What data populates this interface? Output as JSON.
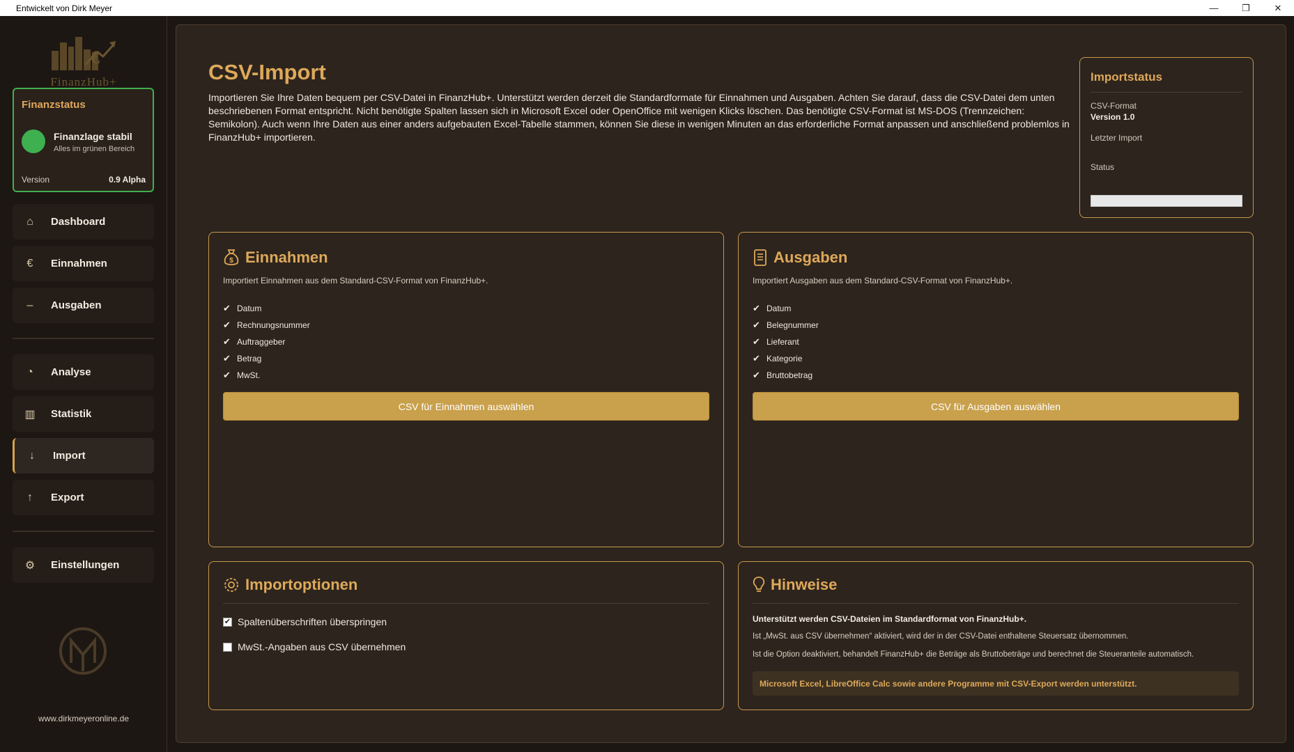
{
  "window": {
    "title": "Entwickelt von Dirk Meyer",
    "controls": {
      "minimize": "—",
      "maximize": "❐",
      "close": "✕"
    }
  },
  "sidebar": {
    "logo_text": "FinanzHub+",
    "finanzstatus": {
      "title": "Finanzstatus",
      "main": "Finanzlage stabil",
      "sub": "Alles im grünen Bereich",
      "version_label": "Version",
      "version_value": "0.9 Alpha",
      "status_color": "#3fb04f"
    },
    "nav": [
      {
        "label": "Dashboard",
        "icon": "home-icon",
        "glyph": "⌂"
      },
      {
        "label": "Einnahmen",
        "icon": "euro-icon",
        "glyph": "€"
      },
      {
        "label": "Ausgaben",
        "icon": "minus-icon",
        "glyph": "–"
      },
      {
        "label": "Analyse",
        "icon": "pie-chart-icon",
        "glyph": "◔"
      },
      {
        "label": "Statistik",
        "icon": "bar-chart-icon",
        "glyph": "▥"
      },
      {
        "label": "Import",
        "icon": "arrow-down-icon",
        "glyph": "↓",
        "active": true
      },
      {
        "label": "Export",
        "icon": "arrow-up-icon",
        "glyph": "↑"
      },
      {
        "label": "Einstellungen",
        "icon": "gear-icon",
        "glyph": "⚙"
      }
    ],
    "website": "www.dirkmeyeronline.de"
  },
  "main": {
    "title": "CSV-Import",
    "intro": "Importieren Sie Ihre Daten bequem per CSV-Datei in FinanzHub+. Unterstützt werden derzeit die Standardformate für Einnahmen und Ausgaben. Achten Sie darauf, dass die CSV-Datei dem unten beschriebenen Format entspricht. Nicht benötigte Spalten lassen sich in Microsoft Excel oder OpenOffice mit wenigen Klicks löschen. Das benötigte CSV-Format ist MS-DOS (Trennzeichen: Semikolon). Auch wenn Ihre Daten aus einer anders aufgebauten Excel-Tabelle stammen, können Sie diese in wenigen Minuten an das erforderliche Format anpassen und anschließend problemlos in FinanzHub+ importieren.",
    "importstatus": {
      "title": "Importstatus",
      "format_label": "CSV-Format",
      "format_value": "Version 1.0",
      "last_import_label": "Letzter Import",
      "last_import_value": "",
      "status_label": "Status",
      "status_value": "",
      "progress": 0
    },
    "einnahmen": {
      "title": "Einnahmen",
      "description": "Importiert Einnahmen aus dem Standard-CSV-Format von FinanzHub+.",
      "fields": [
        "Datum",
        "Rechnungsnummer",
        "Auftraggeber",
        "Betrag",
        "MwSt."
      ],
      "button": "CSV für Einnahmen auswählen"
    },
    "ausgaben": {
      "title": "Ausgaben",
      "description": "Importiert Ausgaben aus dem Standard-CSV-Format von FinanzHub+.",
      "fields": [
        "Datum",
        "Belegnummer",
        "Lieferant",
        "Kategorie",
        "Bruttobetrag"
      ],
      "button": "CSV für Ausgaben auswählen"
    },
    "importoptionen": {
      "title": "Importoptionen",
      "options": [
        {
          "label": "Spaltenüberschriften überspringen",
          "checked": true
        },
        {
          "label": "MwSt.-Angaben aus CSV übernehmen",
          "checked": false
        }
      ]
    },
    "hinweise": {
      "title": "Hinweise",
      "line1": "Unterstützt werden CSV-Dateien im Standardformat von FinanzHub+.",
      "line2": "Ist „MwSt. aus CSV übernehmen“ aktiviert, wird der in der CSV-Datei enthaltene Steuersatz übernommen.",
      "line3": "Ist die Option deaktiviert, behandelt FinanzHub+ die Beträge als Bruttobeträge und berechnet die Steueranteile automatisch.",
      "highlight": "Microsoft Excel, LibreOffice Calc sowie andere Programme mit CSV-Export werden unterstützt."
    }
  },
  "colors": {
    "accent": "#dea95a",
    "button": "#c9a04b",
    "background": "#1d1713",
    "panel": "#2d241d",
    "success": "#3fb04f"
  }
}
